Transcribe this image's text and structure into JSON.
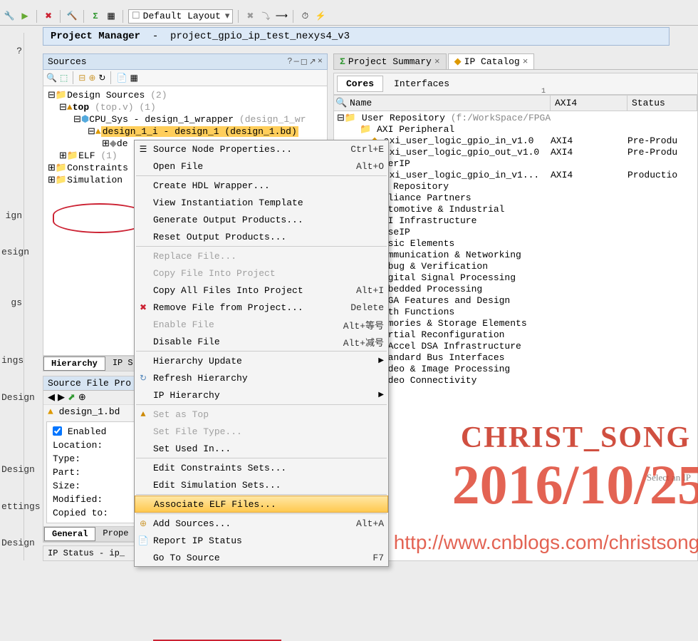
{
  "toolbar": {
    "layout_label": "Default Layout"
  },
  "project_bar": {
    "title": "Project Manager",
    "project": "project_gpio_ip_test_nexys4_v3"
  },
  "left_strip": [
    "?",
    "ign",
    "esign",
    "gs",
    "ings",
    "Design",
    "Design",
    "ettings",
    "Design"
  ],
  "sources": {
    "title": "Sources",
    "tree": {
      "design_sources": {
        "label": "Design Sources",
        "count": "(2)"
      },
      "top": {
        "label": "top",
        "file": "(top.v)",
        "count": "(1)"
      },
      "cpu_sys": {
        "label": "CPU_Sys - design_1_wrapper",
        "file": "(design_1_wr"
      },
      "design1_inst": {
        "prefix": "design_1_i",
        "rest": "design_1 (design_1.bd)"
      },
      "de_trunc": "de",
      "elf": {
        "label": "ELF",
        "count": "(1)"
      },
      "constraints": {
        "label": "Constraints"
      },
      "simulation": {
        "label": "Simulation"
      }
    },
    "tabs": [
      "Hierarchy",
      "IP S"
    ]
  },
  "source_props": {
    "title": "Source File Pro",
    "current": "design_1.bd",
    "enabled_label": "Enabled",
    "fields": [
      {
        "label": "Location:",
        "value": ""
      },
      {
        "label": "Type:",
        "value": ""
      },
      {
        "label": "Part:",
        "value": ""
      },
      {
        "label": "Size:",
        "value": ""
      },
      {
        "label": "Modified:",
        "value": ""
      },
      {
        "label": "Copied to:",
        "value": ""
      }
    ],
    "bottom_tabs": [
      "General",
      "Prope"
    ]
  },
  "ip_status_label": "IP Status - ip_",
  "context_menu": [
    {
      "label": "Source Node Properties...",
      "sc": "Ctrl+E",
      "icon": "props"
    },
    {
      "label": "Open File",
      "sc": "Alt+O"
    },
    {
      "sep": true
    },
    {
      "label": "Create HDL Wrapper..."
    },
    {
      "label": "View Instantiation Template"
    },
    {
      "label": "Generate Output Products..."
    },
    {
      "label": "Reset Output Products..."
    },
    {
      "sep": true
    },
    {
      "label": "Replace File...",
      "disabled": true
    },
    {
      "label": "Copy File Into Project",
      "disabled": true
    },
    {
      "label": "Copy All Files Into Project",
      "sc": "Alt+I"
    },
    {
      "label": "Remove File from Project...",
      "sc": "Delete",
      "icon": "x"
    },
    {
      "label": "Enable File",
      "sc": "Alt+等号",
      "disabled": true
    },
    {
      "label": "Disable File",
      "sc": "Alt+减号"
    },
    {
      "sep": true
    },
    {
      "label": "Hierarchy Update",
      "sub": true
    },
    {
      "label": "Refresh Hierarchy",
      "icon": "refresh"
    },
    {
      "label": "IP Hierarchy",
      "sub": true
    },
    {
      "sep": true
    },
    {
      "label": "Set as Top",
      "disabled": true,
      "icon": "top"
    },
    {
      "label": "Set File Type...",
      "disabled": true
    },
    {
      "label": "Set Used In..."
    },
    {
      "sep": true
    },
    {
      "label": "Edit Constraints Sets..."
    },
    {
      "label": "Edit Simulation Sets..."
    },
    {
      "sep": true
    },
    {
      "label": "Associate ELF Files...",
      "highlighted": true
    },
    {
      "sep": true
    },
    {
      "label": "Add Sources...",
      "sc": "Alt+A",
      "icon": "add"
    },
    {
      "label": "Report IP Status",
      "icon": "report"
    },
    {
      "label": "Go To Source",
      "sc": "F7"
    }
  ],
  "right": {
    "tabs": [
      {
        "label": "Project Summary",
        "icon": "Σ"
      },
      {
        "label": "IP Catalog",
        "icon": "ip",
        "active": true
      }
    ],
    "subtabs": [
      {
        "label": "Cores",
        "active": true
      },
      {
        "label": "Interfaces"
      }
    ],
    "columns": [
      "Name",
      "AXI4",
      "Status"
    ],
    "search_hint": "1",
    "user_repo_label": "User Repository",
    "user_repo_path": "(f:/WorkSpace/FPGA/ip_repo)",
    "rows": [
      {
        "name": "AXI Peripheral",
        "indent": 2,
        "folder": true
      },
      {
        "name": "axi_user_logic_gpio_in_v1.0",
        "indent": 3,
        "axi": "AXI4",
        "status": "Pre-Produ",
        "ip": true
      },
      {
        "name": "axi_user_logic_gpio_out_v1.0",
        "indent": 3,
        "axi": "AXI4",
        "status": "Pre-Produ",
        "ip": true
      },
      {
        "name": "UserIP",
        "indent": 2,
        "folder": true
      },
      {
        "name": "axi_user_logic_gpio_in_v1...",
        "indent": 3,
        "axi": "AXI4",
        "status": "Productio",
        "ip": true
      },
      {
        "name": "vado Repository",
        "indent": 1,
        "folder": true
      },
      {
        "name": "Alliance Partners",
        "indent": 2,
        "folder": true
      },
      {
        "name": "Automotive & Industrial",
        "indent": 2,
        "folder": true
      },
      {
        "name": "AXI Infrastructure",
        "indent": 2,
        "folder": true
      },
      {
        "name": "BaseIP",
        "indent": 2,
        "folder": true
      },
      {
        "name": "Basic Elements",
        "indent": 2,
        "folder": true
      },
      {
        "name": "Communication & Networking",
        "indent": 2,
        "folder": true
      },
      {
        "name": "Debug & Verification",
        "indent": 2,
        "folder": true
      },
      {
        "name": "Digital Signal Processing",
        "indent": 2,
        "folder": true
      },
      {
        "name": "Embedded Processing",
        "indent": 2,
        "folder": true
      },
      {
        "name": "FPGA Features and Design",
        "indent": 2,
        "folder": true
      },
      {
        "name": "Math Functions",
        "indent": 2,
        "folder": true
      },
      {
        "name": "Memories & Storage Elements",
        "indent": 2,
        "folder": true
      },
      {
        "name": "Partial Reconfiguration",
        "indent": 2,
        "folder": true
      },
      {
        "name": "SDAccel DSA Infrastructure",
        "indent": 2,
        "folder": true
      },
      {
        "name": "Standard Bus Interfaces",
        "indent": 2,
        "folder": true
      },
      {
        "name": "Video & Image Processing",
        "indent": 2,
        "folder": true
      },
      {
        "name": "Video Connectivity",
        "indent": 2,
        "folder": true
      }
    ],
    "select_hint": "Select an IP"
  },
  "watermarks": {
    "w1": "CHRIST_SONG",
    "w2": "2016/10/25",
    "w3": "http://www.cnblogs.com/christsong/"
  }
}
